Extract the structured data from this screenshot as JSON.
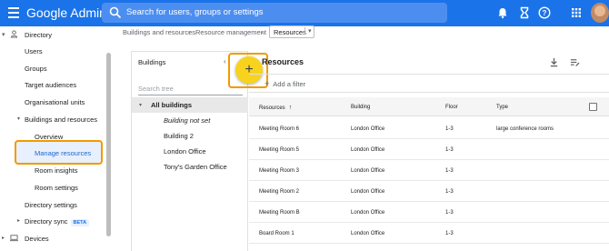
{
  "topbar": {
    "brand": "Google Admin",
    "search_placeholder": "Search for users, groups or settings",
    "colors": {
      "bar": "#1a73e8"
    }
  },
  "sidebar": {
    "items": [
      {
        "label": "Directory"
      },
      {
        "label": "Users"
      },
      {
        "label": "Groups"
      },
      {
        "label": "Target audiences"
      },
      {
        "label": "Organisational units"
      },
      {
        "label": "Buildings and resources"
      },
      {
        "label": "Overview"
      },
      {
        "label": "Manage resources"
      },
      {
        "label": "Room insights"
      },
      {
        "label": "Room settings"
      },
      {
        "label": "Directory settings"
      },
      {
        "label": "Directory sync"
      },
      {
        "label": "Devices"
      }
    ],
    "beta": "BETA"
  },
  "breadcrumb": {
    "items": [
      "Buildings and resources",
      "Resource management",
      "Resources"
    ]
  },
  "buildings": {
    "title": "Buildings",
    "search_placeholder": "Search tree",
    "tree": [
      "All buildings",
      "Building not set",
      "Building 2",
      "London Office",
      "Tony's Garden Office"
    ]
  },
  "fab": {
    "label": "+"
  },
  "resources": {
    "title": "Resources",
    "filter": "Add a filter",
    "columns": [
      "Resources",
      "Building",
      "Floor",
      "Type"
    ],
    "rows": [
      {
        "name": "Meeting Room 6",
        "building": "London Office",
        "floor": "1-3",
        "type": "large conference rooms"
      },
      {
        "name": "Meeting Room 5",
        "building": "London Office",
        "floor": "1-3",
        "type": ""
      },
      {
        "name": "Meeting Room 3",
        "building": "London Office",
        "floor": "1-3",
        "type": ""
      },
      {
        "name": "Meeting Room 2",
        "building": "London Office",
        "floor": "1-3",
        "type": ""
      },
      {
        "name": "Meeting Room B",
        "building": "London Office",
        "floor": "1-3",
        "type": ""
      },
      {
        "name": "Board Room 1",
        "building": "London Office",
        "floor": "1-3",
        "type": ""
      }
    ]
  }
}
